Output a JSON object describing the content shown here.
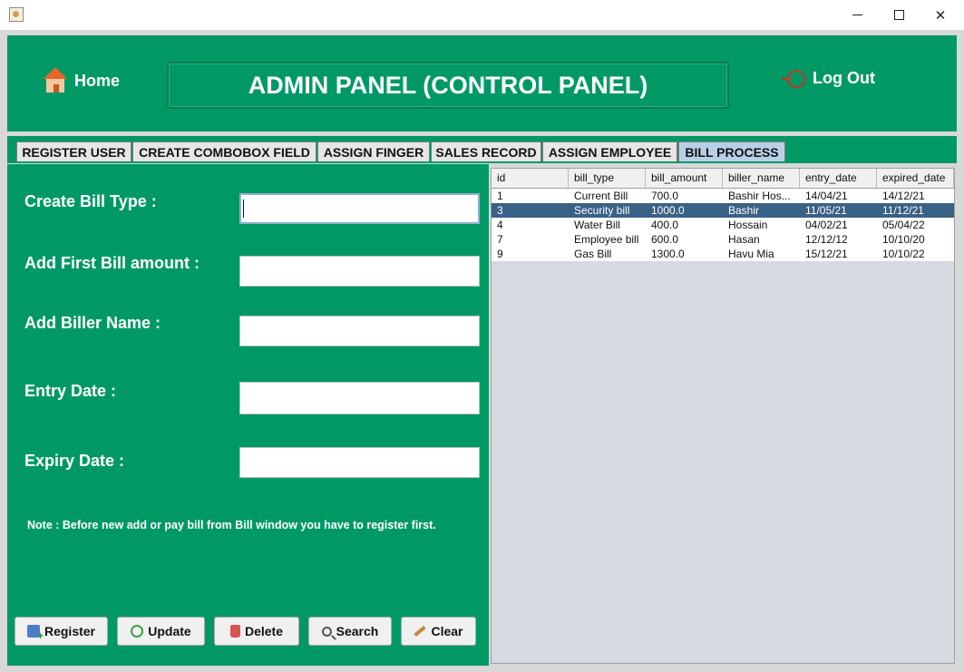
{
  "window": {
    "icon": "java-cup-icon"
  },
  "header": {
    "home_label": "Home",
    "title": "ADMIN PANEL (CONTROL PANEL)",
    "logout_label": "Log Out",
    "background_color": "#009966"
  },
  "tabs": [
    {
      "label": "REGISTER USER"
    },
    {
      "label": "CREATE COMBOBOX FIELD"
    },
    {
      "label": "ASSIGN FINGER"
    },
    {
      "label": "SALES RECORD"
    },
    {
      "label": "ASSIGN EMPLOYEE"
    },
    {
      "label": "BILL PROCESS",
      "active": true
    }
  ],
  "form": {
    "bill_type_label": "Create Bill Type :",
    "bill_type_value": "",
    "first_amount_label": "Add First Bill amount :",
    "first_amount_value": "",
    "biller_name_label": "Add Biller Name :",
    "biller_name_value": "",
    "entry_date_label": "Entry Date :",
    "entry_date_value": "",
    "expiry_date_label": "Expiry Date :",
    "expiry_date_value": "",
    "note": "Note : Before new add or pay bill from Bill window you have to register first."
  },
  "buttons": {
    "register": "Register",
    "update": "Update",
    "delete": "Delete",
    "search": "Search",
    "clear": "Clear"
  },
  "table": {
    "columns": [
      "id",
      "bill_type",
      "bill_amount",
      "biller_name",
      "entry_date",
      "expired_date"
    ],
    "rows": [
      [
        "1",
        "Current Bill",
        "700.0",
        "Bashir Hos...",
        "14/04/21",
        "14/12/21"
      ],
      [
        "3",
        "Security bill",
        "1000.0",
        "Bashir",
        "11/05/21",
        "11/12/21"
      ],
      [
        "4",
        "Water Bill",
        "400.0",
        "Hossain",
        "04/02/21",
        "05/04/22"
      ],
      [
        "7",
        "Employee bill",
        "600.0",
        "Hasan",
        "12/12/12",
        "10/10/20"
      ],
      [
        "9",
        "Gas Bill",
        "1300.0",
        "Havu Mia",
        "15/12/21",
        "10/10/22"
      ]
    ],
    "selected_row": 1,
    "selection_color": "#3a6186"
  }
}
